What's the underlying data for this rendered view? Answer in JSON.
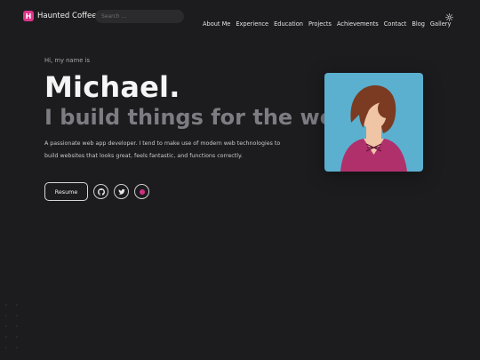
{
  "brand": {
    "name": "Haunted Coffee",
    "logo_letter": "H",
    "accent": "#e0338c"
  },
  "search": {
    "placeholder": "Search ..."
  },
  "nav": {
    "items": [
      {
        "label": "About Me"
      },
      {
        "label": "Experience"
      },
      {
        "label": "Education"
      },
      {
        "label": "Projects"
      },
      {
        "label": "Achievements"
      },
      {
        "label": "Contact"
      },
      {
        "label": "Blog"
      },
      {
        "label": "Gallery"
      }
    ],
    "theme_icon": "sun-icon"
  },
  "hero": {
    "greeting": "Hi, my name is",
    "name": "Michael.",
    "tagline": "I build things for the web",
    "bio": "A passionate web app developer. I tend to make use of modern web technologies to build websites that looks great, feels fantastic, and functions correctly.",
    "resume_label": "Resume",
    "socials": [
      "github-icon",
      "twitter-icon",
      "dribbble-icon"
    ]
  },
  "colors": {
    "background": "#1c1c1e",
    "tagline": "#7c7c82",
    "avatar_bg": "#5bb0cf",
    "shirt": "#b0306c",
    "hair": "#7a3b22"
  }
}
